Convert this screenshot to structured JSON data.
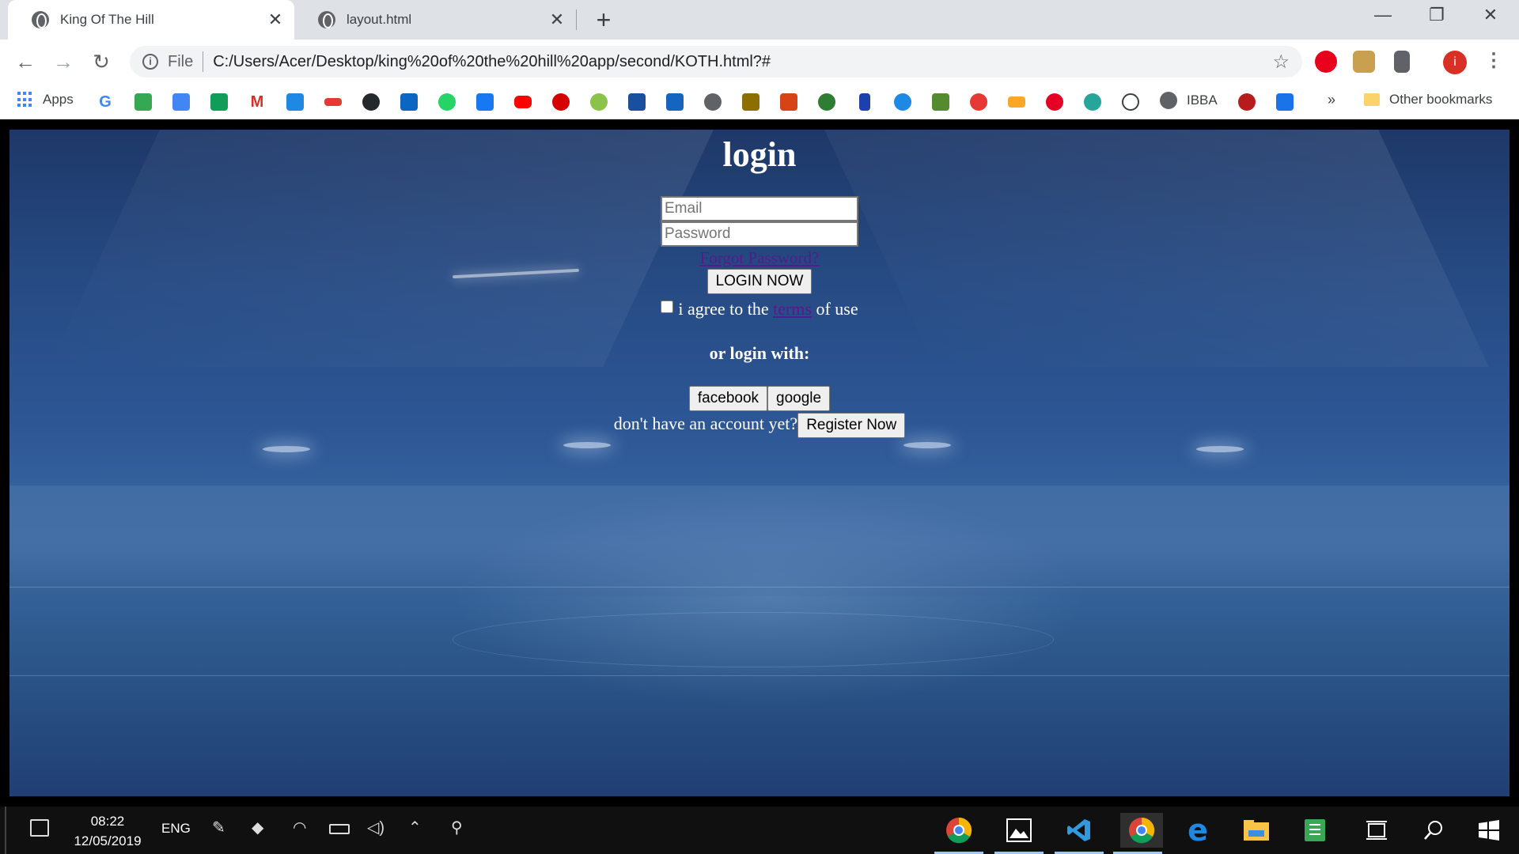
{
  "browser": {
    "tabs": [
      {
        "title": "King Of The Hill",
        "active": true
      },
      {
        "title": "layout.html",
        "active": false
      }
    ],
    "new_tab_symbol": "+",
    "window_controls": {
      "minimize": "—",
      "restore": "❐",
      "close": "✕"
    },
    "omnibox": {
      "scheme_label": "File",
      "url": "C:/Users/Acer/Desktop/king%20of%20the%20hill%20app/second/KOTH.html?#"
    },
    "profile_initial": "i",
    "bookmarks": {
      "apps_label": "Apps",
      "ibba_label": "IBBA",
      "more_label": "»",
      "other_label": "Other bookmarks"
    }
  },
  "page": {
    "title": "login",
    "email_placeholder": "Email",
    "password_placeholder": "Password",
    "forgot_password": "Forgot Password?",
    "login_button": "LOGIN NOW",
    "terms": {
      "prefix": "i agree to the",
      "link": "terms",
      "suffix": "of use"
    },
    "or_login_with": "or login with:",
    "social": {
      "facebook": "facebook",
      "google": "google"
    },
    "register_prompt": "don't have an account yet?",
    "register_button": "Register Now"
  },
  "taskbar": {
    "time": "08:22",
    "date": "12/05/2019",
    "language": "ENG"
  }
}
